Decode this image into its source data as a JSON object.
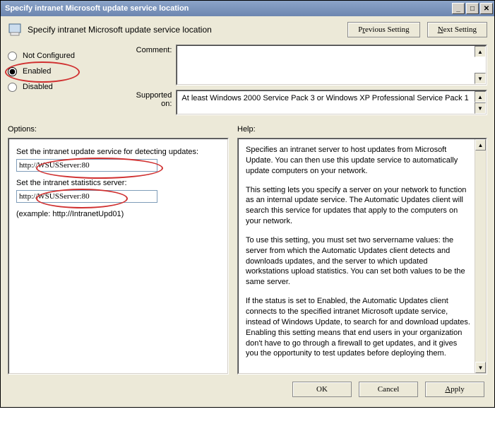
{
  "titlebar": {
    "text": "Specify intranet Microsoft update service location"
  },
  "header": {
    "title": "Specify intranet Microsoft update service location",
    "prev_btn_pre": "P",
    "prev_btn_ul": "r",
    "prev_btn_post": "evious Setting",
    "next_btn_pre": "",
    "next_btn_ul": "N",
    "next_btn_post": "ext Setting"
  },
  "state": {
    "not_configured": "Not Configured",
    "enabled": "Enabled",
    "disabled": "Disabled",
    "selected": "enabled"
  },
  "labels": {
    "comment": "Comment:",
    "supported": "Supported on:",
    "options": "Options:",
    "help": "Help:"
  },
  "comment_value": "",
  "supported_text": "At least Windows 2000 Service Pack 3 or Windows XP Professional Service Pack 1",
  "options": {
    "detect_label": "Set the intranet update service for detecting updates:",
    "detect_value": "http://WSUSServer:80",
    "stats_label": "Set the intranet statistics server:",
    "stats_value": "http://WSUSServer:80",
    "example": "(example: http://IntranetUpd01)"
  },
  "help": {
    "p1": "Specifies an intranet server to host updates from Microsoft Update. You can then use this update service to automatically update computers on your network.",
    "p2": "This setting lets you specify a server on your network to function as an internal update service. The Automatic Updates client will search this service for updates that apply to the computers on your network.",
    "p3": "To use this setting, you must set two servername values: the server from which the Automatic Updates client detects and downloads updates, and the server to which updated workstations upload statistics. You can set both values to be the same server.",
    "p4": "If the status is set to Enabled, the Automatic Updates client connects to the specified intranet Microsoft update service, instead of Windows Update, to search for and download updates. Enabling this setting means that end users in your organization don't have to go through a firewall to get updates, and it gives you the opportunity to test updates before deploying them."
  },
  "footer": {
    "ok": "OK",
    "cancel": "Cancel",
    "apply_ul": "A",
    "apply_post": "pply"
  }
}
